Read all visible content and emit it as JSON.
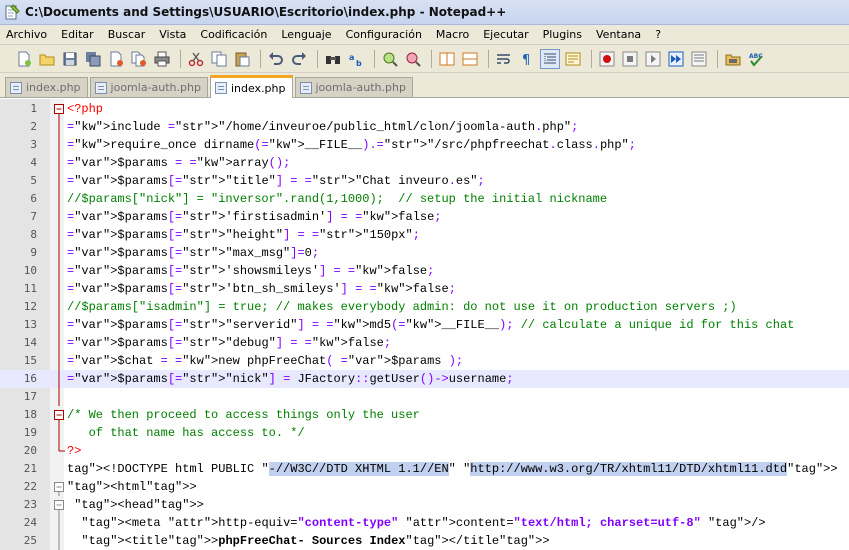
{
  "window": {
    "title": "C:\\Documents and Settings\\USUARIO\\Escritorio\\index.php - Notepad++"
  },
  "menu": [
    "Archivo",
    "Editar",
    "Buscar",
    "Vista",
    "Codificación",
    "Lenguaje",
    "Configuración",
    "Macro",
    "Ejecutar",
    "Plugins",
    "Ventana",
    "?"
  ],
  "toolbar": {
    "buttons": [
      "new-file",
      "open-file",
      "save",
      "save-all",
      "close",
      "close-all",
      "print",
      "cut",
      "copy",
      "paste",
      "undo",
      "redo",
      "find",
      "replace",
      "zoom-in",
      "zoom-out",
      "sync-vertical",
      "sync-horizontal",
      "word-wrap",
      "show-all-chars",
      "indent-guide",
      "user-defined-language",
      "record-macro",
      "stop-recording",
      "play-macro",
      "run-macro-multiple",
      "save-macro",
      "open-folder",
      "spell-check"
    ]
  },
  "tabs": [
    {
      "label": "index.php",
      "active": false
    },
    {
      "label": "joomla-auth.php",
      "active": false
    },
    {
      "label": "index.php",
      "active": true
    },
    {
      "label": "joomla-auth.php",
      "active": false
    }
  ],
  "editor": {
    "current_line": 16,
    "lines": [
      {
        "n": "1",
        "text": "<?php"
      },
      {
        "n": "2",
        "text": "include \"/home/inveuroe/public_html/clon/joomla-auth.php\";"
      },
      {
        "n": "3",
        "text": "require_once dirname(__FILE__).\"/src/phpfreechat.class.php\";"
      },
      {
        "n": "4",
        "text": "$params = array();"
      },
      {
        "n": "5",
        "text": "$params[\"title\"] = \"Chat inveuro.es\";"
      },
      {
        "n": "6",
        "text": "//$params[\"nick\"] = \"inversor\".rand(1,1000);  // setup the initial nickname"
      },
      {
        "n": "7",
        "text": "$params['firstisadmin'] = false;"
      },
      {
        "n": "8",
        "text": "$params[\"height\"] = \"150px\";"
      },
      {
        "n": "9",
        "text": "$params[\"max_msg\"]=0;"
      },
      {
        "n": "10",
        "text": "$params['showsmileys'] = false;"
      },
      {
        "n": "11",
        "text": "$params['btn_sh_smileys'] = false;"
      },
      {
        "n": "12",
        "text": "//$params[\"isadmin\"] = true; // makes everybody admin: do not use it on production servers ;)"
      },
      {
        "n": "13",
        "text": "$params[\"serverid\"] = md5(__FILE__); // calculate a unique id for this chat"
      },
      {
        "n": "14",
        "text": "$params[\"debug\"] = false;"
      },
      {
        "n": "15",
        "text": "$chat = new phpFreeChat( $params );"
      },
      {
        "n": "16",
        "text": "$params[\"nick\"] = JFactory::getUser()->username;"
      },
      {
        "n": "17",
        "text": ""
      },
      {
        "n": "18",
        "text": "/* We then proceed to access things only the user"
      },
      {
        "n": "19",
        "text": "   of that name has access to. */"
      },
      {
        "n": "20",
        "text": "?>"
      },
      {
        "n": "21",
        "text": "<!DOCTYPE html PUBLIC \"-//W3C//DTD XHTML 1.1//EN\" \"http://www.w3.org/TR/xhtml11/DTD/xhtml11.dtd\">"
      },
      {
        "n": "22",
        "text": "<html>"
      },
      {
        "n": "23",
        "text": " <head>"
      },
      {
        "n": "24",
        "text": "  <meta http-equiv=\"content-type\" content=\"text/html; charset=utf-8\" />"
      },
      {
        "n": "25",
        "text": "  <title>phpFreeChat- Sources Index</title>"
      }
    ]
  }
}
